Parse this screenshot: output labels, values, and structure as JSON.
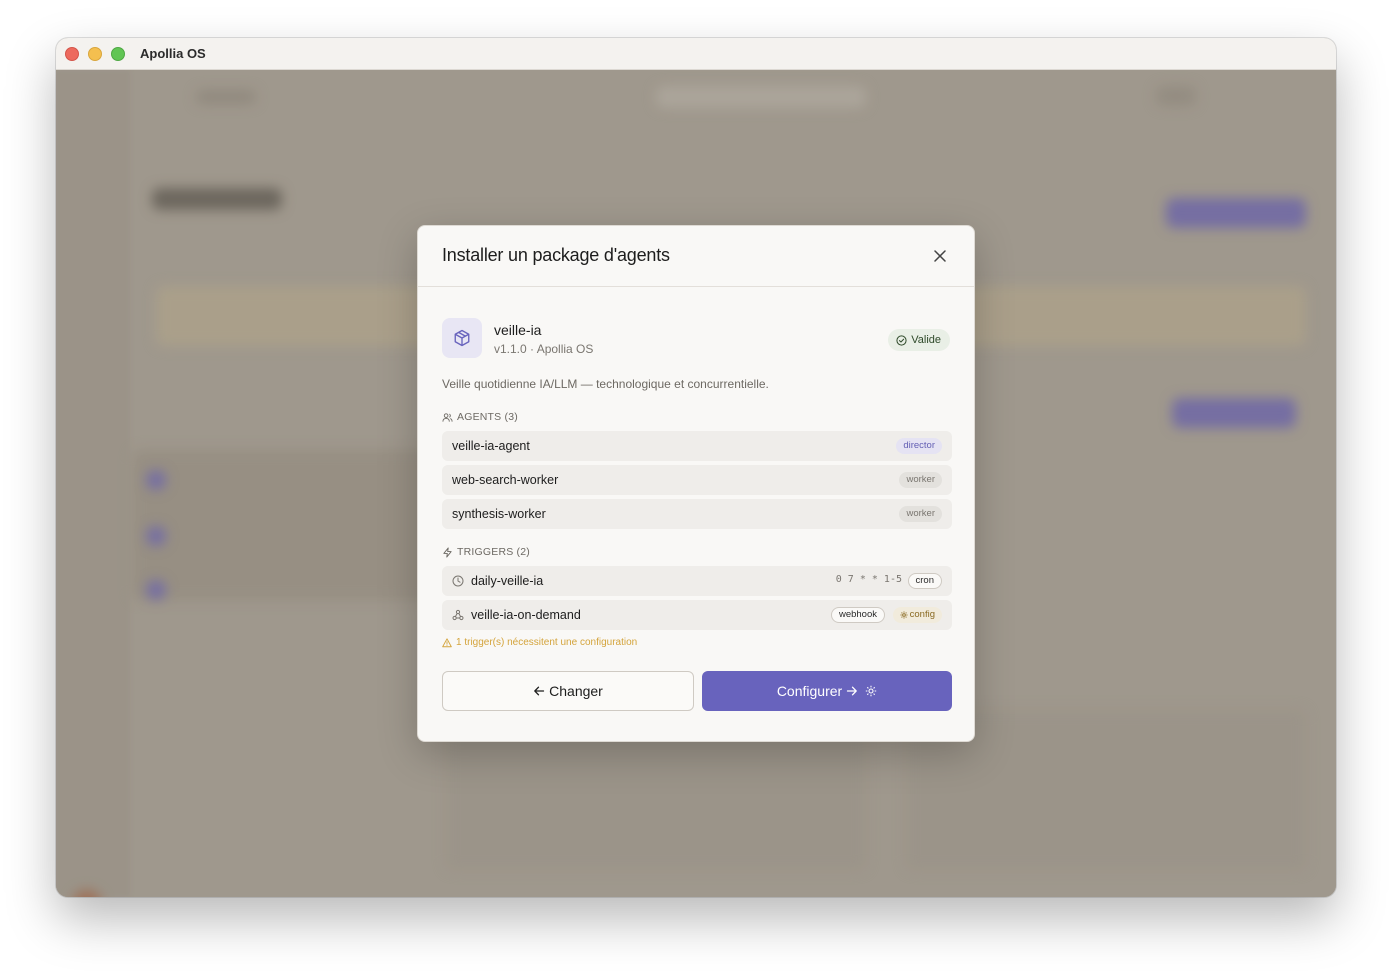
{
  "window": {
    "title": "Apollia OS"
  },
  "modal": {
    "title": "Installer un package d'agents",
    "package": {
      "name": "veille-ia",
      "meta": "v1.1.0 · Apollia OS",
      "status": "Valide",
      "description": "Veille quotidienne IA/LLM — technologique et concurrentielle."
    },
    "agents_label": "AGENTS (3)",
    "agents": [
      {
        "name": "veille-ia-agent",
        "role": "director"
      },
      {
        "name": "web-search-worker",
        "role": "worker"
      },
      {
        "name": "synthesis-worker",
        "role": "worker"
      }
    ],
    "triggers_label": "TRIGGERS (2)",
    "triggers": [
      {
        "name": "daily-veille-ia",
        "icon": "clock-icon",
        "schedule": "0 7 * * 1-5",
        "type": "cron"
      },
      {
        "name": "veille-ia-on-demand",
        "icon": "webhook-icon",
        "type": "webhook",
        "config": "config"
      }
    ],
    "warning": "1 trigger(s) nécessitent une configuration",
    "back_button": "Changer",
    "primary_button": "Configurer"
  },
  "colors": {
    "accent": "#6863bd",
    "warning": "#d4a43c",
    "valid_bg": "#e9efe6"
  }
}
